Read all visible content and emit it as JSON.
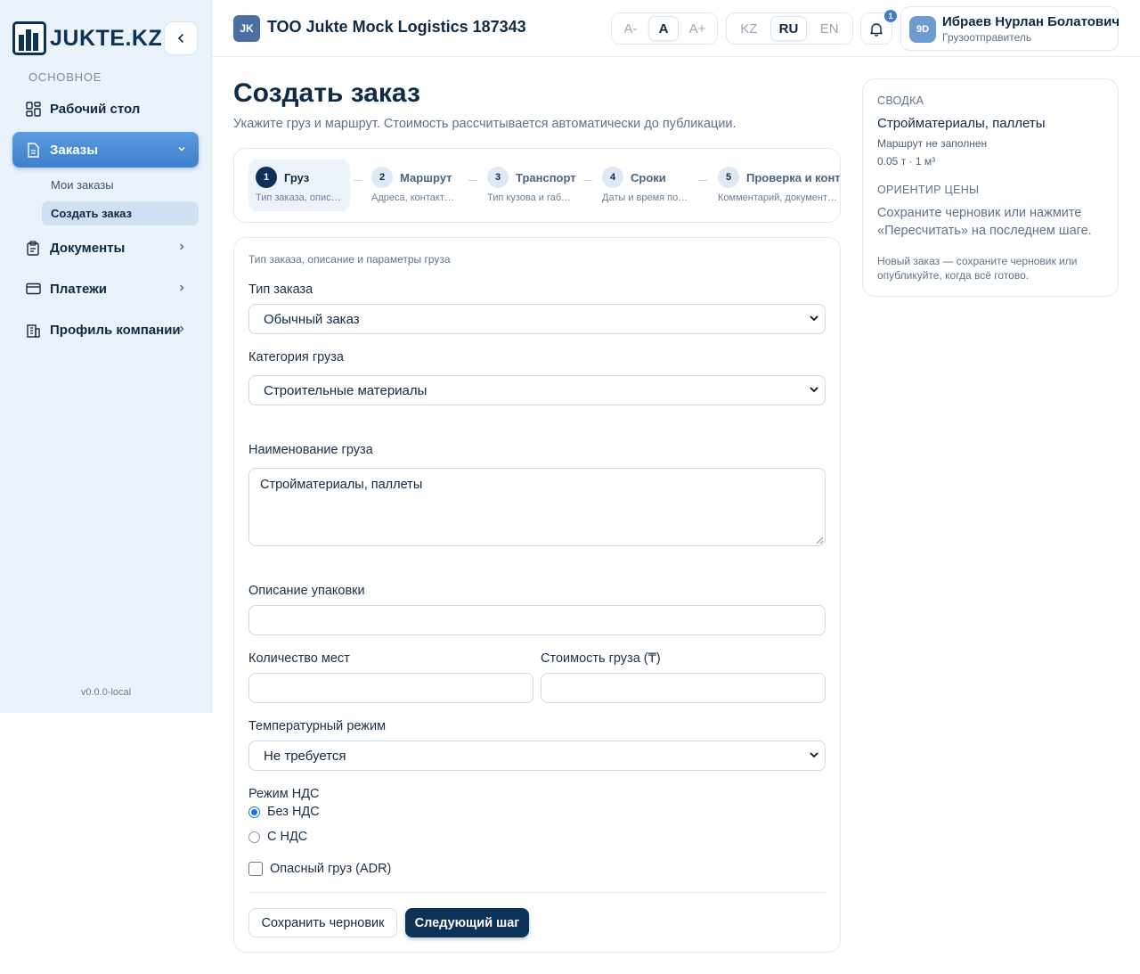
{
  "brand": {
    "name": "JUKTE.KZ"
  },
  "sidebar": {
    "section_label": "ОСНОВНОЕ",
    "items": [
      {
        "label": "Рабочий стол",
        "icon": "dashboard-icon"
      },
      {
        "label": "Заказы",
        "icon": "document-icon"
      },
      {
        "label": "Документы",
        "icon": "clipboard-icon"
      },
      {
        "label": "Платежи",
        "icon": "credit-card-icon"
      },
      {
        "label": "Профиль компании",
        "icon": "building-icon"
      }
    ],
    "sub_items": [
      {
        "label": "Мои заказы"
      },
      {
        "label": "Создать заказ"
      }
    ],
    "version": "v0.0.0-local"
  },
  "header": {
    "org_badge": "JK",
    "org_name": "ТОО Jukte Mock Logistics 187343",
    "font_sizes": [
      "A-",
      "A",
      "A+"
    ],
    "languages": [
      "KZ",
      "RU",
      "EN"
    ],
    "active_language": "RU",
    "notification_count": "1",
    "user": {
      "initials": "9D",
      "name": "Ибраев Нурлан Болатович",
      "role": "Грузоотправитель"
    }
  },
  "page": {
    "title": "Создать заказ",
    "subtitle": "Укажите груз и маршрут. Стоимость рассчитывается автоматически до публикации."
  },
  "steps": [
    {
      "num": "1",
      "title": "Груз",
      "desc": "Тип заказа, описание и параметры груза"
    },
    {
      "num": "2",
      "title": "Маршрут",
      "desc": "Адреса, контакты отправителя"
    },
    {
      "num": "3",
      "title": "Транспорт",
      "desc": "Тип кузова и габариты"
    },
    {
      "num": "4",
      "title": "Сроки",
      "desc": "Даты и время погрузки"
    },
    {
      "num": "5",
      "title": "Проверка и контакты",
      "desc": "Комментарий, документы и"
    }
  ],
  "form": {
    "hint": "Тип заказа, описание и параметры груза",
    "order_type": {
      "label": "Тип заказа",
      "value": "Обычный заказ"
    },
    "cargo_category": {
      "label": "Категория груза",
      "value": "Строительные материалы"
    },
    "cargo_name": {
      "label": "Наименование груза",
      "value": "Стройматериалы, паллеты"
    },
    "packaging": {
      "label": "Описание упаковки",
      "value": ""
    },
    "places": {
      "label": "Количество мест",
      "value": ""
    },
    "cargo_value": {
      "label": "Стоимость груза (₸)",
      "value": ""
    },
    "temperature": {
      "label": "Температурный режим",
      "value": "Не требуется"
    },
    "vat": {
      "label": "Режим НДС",
      "options": [
        "Без НДС",
        "С НДС"
      ],
      "selected": "Без НДС"
    },
    "adr": {
      "label": "Опасный груз (ADR)",
      "checked": false
    },
    "save_draft": "Сохранить черновик",
    "next_step": "Следующий шаг"
  },
  "summary": {
    "heading": "СВОДКА",
    "cargo": "Стройматериалы, паллеты",
    "route": "Маршрут не заполнен",
    "weight_volume": "0.05 т · 1 м³",
    "price_heading": "ОРИЕНТИР ЦЕНЫ",
    "price_text": "Сохраните черновик или нажмите «Пересчитать» на последнем шаге.",
    "note": "Новый заказ — сохраните черновик или опубликуйте, когда всё готово."
  },
  "colors": {
    "brand": "#0c3357",
    "accent": "#3f7fcc",
    "sidebar_bg": "#eaf2fb"
  }
}
